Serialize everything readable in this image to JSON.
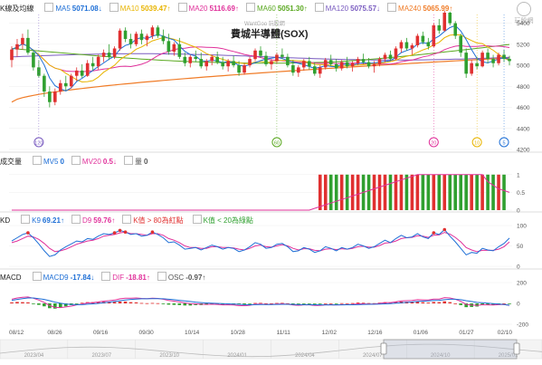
{
  "title": "費城半導體(SOX)",
  "watermark": "WantGoo 玩股網",
  "logo_text": "玩股網",
  "header_k": {
    "label": "K線及均線",
    "items": [
      {
        "name": "MA5",
        "value": "5071.08↓",
        "color": "#1e6fd6"
      },
      {
        "name": "MA10",
        "value": "5039.47↑",
        "color": "#e8b400"
      },
      {
        "name": "MA20",
        "value": "5116.69↑",
        "color": "#e0309a"
      },
      {
        "name": "MA60",
        "value": "5051.30↑",
        "color": "#5aa820"
      },
      {
        "name": "MA120",
        "value": "5075.57↓",
        "color": "#7a5cc0"
      },
      {
        "name": "MA240",
        "value": "5065.99↑",
        "color": "#f07c28"
      }
    ]
  },
  "header_vol": {
    "label": "成交量",
    "items": [
      {
        "name": "MV5",
        "value": "0",
        "color": "#1e6fd6"
      },
      {
        "name": "MV20",
        "value": "0.5↓",
        "color": "#e0309a"
      },
      {
        "name": "量",
        "value": "0",
        "color": "#555"
      }
    ]
  },
  "header_kd": {
    "label": "KD",
    "items": [
      {
        "name": "K9",
        "value": "69.21↑",
        "color": "#1e6fd6"
      },
      {
        "name": "D9",
        "value": "59.76↑",
        "color": "#e0309a"
      },
      {
        "name": "K值 > 80為紅點",
        "value": "",
        "color": "#e03030"
      },
      {
        "name": "K值 < 20為綠點",
        "value": "",
        "color": "#30a030"
      }
    ]
  },
  "header_macd": {
    "label": "MACD",
    "items": [
      {
        "name": "MACD9",
        "value": "-17.84↓",
        "color": "#1e6fd6"
      },
      {
        "name": "DIF",
        "value": "-18.81↑",
        "color": "#e0309a"
      },
      {
        "name": "OSC",
        "value": "-0.97↑",
        "color": "#555"
      }
    ]
  },
  "chart_data": {
    "type": "candlestick",
    "price_axis": {
      "ticks": [
        4200,
        4400,
        4600,
        4800,
        5000,
        5200,
        5400
      ],
      "range": [
        4200,
        5500
      ]
    },
    "volume_axis": {
      "ticks": [
        0,
        0.5,
        1
      ]
    },
    "kd_axis": {
      "ticks": [
        0,
        50,
        100
      ]
    },
    "macd_axis": {
      "ticks": [
        -200,
        0,
        200
      ]
    },
    "date_ticks": [
      "08/12",
      "08/26",
      "09/16",
      "09/30",
      "10/14",
      "10/28",
      "11/11",
      "12/02",
      "12/16",
      "01/06",
      "01/27",
      "02/10"
    ],
    "scroll_ticks": [
      "2023/04",
      "2023/07",
      "2023/10",
      "2024/01",
      "2024/04",
      "2024/07",
      "2024/10",
      "2025/01"
    ],
    "markers": [
      {
        "label": "120",
        "color": "#7a5cc0",
        "index": 5
      },
      {
        "label": "60",
        "color": "#5aa820",
        "index": 49
      },
      {
        "label": "20",
        "color": "#e0309a",
        "index": 78
      },
      {
        "label": "10",
        "color": "#e8b400",
        "index": 86
      },
      {
        "label": "5",
        "color": "#1e6fd6",
        "index": 91
      }
    ],
    "candles": [
      [
        5050,
        5180,
        4980,
        5150
      ],
      [
        5150,
        5250,
        5080,
        5200
      ],
      [
        5200,
        5300,
        5150,
        5260
      ],
      [
        5260,
        5340,
        5100,
        5120
      ],
      [
        5120,
        5150,
        4950,
        4980
      ],
      [
        4980,
        5050,
        4880,
        4900
      ],
      [
        4900,
        4920,
        4700,
        4750
      ],
      [
        4750,
        4800,
        4600,
        4650
      ],
      [
        4650,
        4780,
        4620,
        4750
      ],
      [
        4750,
        4860,
        4720,
        4830
      ],
      [
        4830,
        4900,
        4760,
        4800
      ],
      [
        4800,
        4920,
        4780,
        4900
      ],
      [
        4900,
        4980,
        4850,
        4950
      ],
      [
        4950,
        5010,
        4880,
        4900
      ],
      [
        4900,
        5050,
        4890,
        5020
      ],
      [
        5020,
        5080,
        4950,
        4990
      ],
      [
        4990,
        5100,
        4960,
        5080
      ],
      [
        5080,
        5150,
        5030,
        5120
      ],
      [
        5120,
        5200,
        5050,
        5080
      ],
      [
        5080,
        5180,
        5060,
        5160
      ],
      [
        5160,
        5350,
        5140,
        5330
      ],
      [
        5330,
        5360,
        5220,
        5250
      ],
      [
        5250,
        5300,
        5160,
        5200
      ],
      [
        5200,
        5320,
        5180,
        5300
      ],
      [
        5300,
        5340,
        5200,
        5240
      ],
      [
        5240,
        5300,
        5180,
        5280
      ],
      [
        5280,
        5380,
        5250,
        5360
      ],
      [
        5360,
        5380,
        5260,
        5280
      ],
      [
        5280,
        5340,
        5200,
        5230
      ],
      [
        5230,
        5300,
        5100,
        5130
      ],
      [
        5130,
        5220,
        5090,
        5200
      ],
      [
        5200,
        5260,
        5060,
        5080
      ],
      [
        5080,
        5120,
        4990,
        5020
      ],
      [
        5020,
        5100,
        4980,
        5080
      ],
      [
        5080,
        5140,
        5030,
        5060
      ],
      [
        5060,
        5120,
        4970,
        4990
      ],
      [
        4990,
        5060,
        4950,
        5040
      ],
      [
        5040,
        5100,
        5000,
        5080
      ],
      [
        5080,
        5130,
        5010,
        5030
      ],
      [
        5030,
        5080,
        4960,
        4990
      ],
      [
        4990,
        5060,
        4940,
        5040
      ],
      [
        5040,
        5090,
        4980,
        5000
      ],
      [
        5000,
        5040,
        4900,
        4930
      ],
      [
        4930,
        5020,
        4910,
        5000
      ],
      [
        5000,
        5080,
        4980,
        5060
      ],
      [
        5060,
        5160,
        5040,
        5140
      ],
      [
        5140,
        5180,
        5070,
        5090
      ],
      [
        5090,
        5130,
        4990,
        5010
      ],
      [
        5010,
        5060,
        4960,
        5040
      ],
      [
        5040,
        5120,
        5020,
        5100
      ],
      [
        5100,
        5160,
        5060,
        5080
      ],
      [
        5080,
        5110,
        4980,
        5000
      ],
      [
        5000,
        5050,
        4900,
        4930
      ],
      [
        4930,
        5000,
        4890,
        4980
      ],
      [
        4980,
        5060,
        4950,
        5040
      ],
      [
        5040,
        5080,
        4960,
        4990
      ],
      [
        4990,
        5030,
        4900,
        4920
      ],
      [
        4920,
        5000,
        4880,
        4980
      ],
      [
        4980,
        5070,
        4960,
        5050
      ],
      [
        5050,
        5100,
        4990,
        5010
      ],
      [
        5010,
        5060,
        4940,
        4970
      ],
      [
        4970,
        5050,
        4950,
        5030
      ],
      [
        5030,
        5080,
        4970,
        4990
      ],
      [
        4990,
        5040,
        4940,
        5020
      ],
      [
        5020,
        5080,
        5000,
        5060
      ],
      [
        5060,
        5110,
        5010,
        5030
      ],
      [
        5030,
        5070,
        4970,
        4990
      ],
      [
        4990,
        5040,
        4930,
        5010
      ],
      [
        5010,
        5080,
        4990,
        5060
      ],
      [
        5060,
        5120,
        5030,
        5100
      ],
      [
        5100,
        5140,
        5040,
        5060
      ],
      [
        5060,
        5180,
        5050,
        5160
      ],
      [
        5160,
        5240,
        5120,
        5220
      ],
      [
        5220,
        5260,
        5140,
        5160
      ],
      [
        5160,
        5210,
        5100,
        5190
      ],
      [
        5190,
        5300,
        5170,
        5280
      ],
      [
        5280,
        5320,
        5200,
        5220
      ],
      [
        5220,
        5260,
        5150,
        5180
      ],
      [
        5180,
        5400,
        5170,
        5380
      ],
      [
        5380,
        5440,
        5300,
        5330
      ],
      [
        5330,
        5520,
        5320,
        5500
      ],
      [
        5500,
        5510,
        5380,
        5400
      ],
      [
        5400,
        5420,
        5250,
        5280
      ],
      [
        5280,
        5300,
        5080,
        5120
      ],
      [
        5120,
        5160,
        4880,
        4920
      ],
      [
        4920,
        5050,
        4900,
        5020
      ],
      [
        5020,
        5080,
        4960,
        4990
      ],
      [
        4990,
        5140,
        4980,
        5120
      ],
      [
        5120,
        5160,
        5020,
        5060
      ],
      [
        5060,
        5100,
        4980,
        5020
      ],
      [
        5020,
        5120,
        5000,
        5100
      ],
      [
        5100,
        5150,
        5030,
        5060
      ],
      [
        5060,
        5090,
        5000,
        5040
      ]
    ],
    "kd_k": [
      62,
      70,
      78,
      82,
      70,
      55,
      38,
      24,
      28,
      40,
      48,
      55,
      62,
      60,
      68,
      66,
      74,
      80,
      78,
      82,
      88,
      84,
      78,
      80,
      74,
      76,
      84,
      78,
      70,
      58,
      60,
      52,
      42,
      44,
      46,
      40,
      46,
      52,
      48,
      42,
      46,
      44,
      36,
      40,
      48,
      58,
      54,
      44,
      46,
      54,
      56,
      48,
      36,
      38,
      46,
      42,
      34,
      38,
      48,
      44,
      38,
      46,
      42,
      46,
      54,
      50,
      44,
      48,
      56,
      64,
      58,
      68,
      76,
      70,
      72,
      80,
      72,
      68,
      82,
      78,
      90,
      74,
      60,
      44,
      28,
      34,
      32,
      44,
      40,
      38,
      48,
      56,
      69
    ],
    "kd_d": [
      58,
      62,
      68,
      74,
      72,
      66,
      56,
      44,
      36,
      38,
      42,
      48,
      54,
      58,
      62,
      64,
      68,
      74,
      76,
      78,
      82,
      84,
      80,
      80,
      78,
      76,
      80,
      80,
      76,
      68,
      64,
      58,
      50,
      46,
      46,
      44,
      44,
      48,
      48,
      46,
      46,
      45,
      42,
      40,
      44,
      50,
      52,
      48,
      47,
      50,
      53,
      50,
      44,
      40,
      43,
      43,
      39,
      38,
      42,
      43,
      41,
      43,
      42,
      44,
      48,
      49,
      47,
      47,
      51,
      57,
      58,
      62,
      68,
      70,
      71,
      75,
      74,
      71,
      76,
      77,
      83,
      79,
      71,
      60,
      46,
      40,
      36,
      39,
      39,
      39,
      42,
      48,
      59.76
    ],
    "macd_dif": [
      40,
      52,
      58,
      62,
      50,
      32,
      10,
      -20,
      -38,
      -40,
      -34,
      -26,
      -14,
      -6,
      4,
      8,
      14,
      22,
      26,
      32,
      44,
      50,
      50,
      52,
      48,
      46,
      50,
      48,
      40,
      28,
      22,
      14,
      4,
      -2,
      -4,
      -8,
      -10,
      -8,
      -10,
      -14,
      -14,
      -16,
      -22,
      -22,
      -18,
      -8,
      -6,
      -10,
      -10,
      -6,
      -4,
      -8,
      -16,
      -18,
      -14,
      -14,
      -20,
      -20,
      -14,
      -14,
      -16,
      -12,
      -12,
      -10,
      -4,
      -4,
      -6,
      -6,
      0,
      8,
      8,
      16,
      24,
      26,
      28,
      36,
      34,
      32,
      42,
      42,
      56,
      52,
      40,
      20,
      -10,
      -16,
      -20,
      -12,
      -14,
      -16,
      -12,
      -10,
      -18.81
    ],
    "macd_signal": [
      30,
      38,
      46,
      52,
      52,
      46,
      38,
      26,
      12,
      2,
      -6,
      -10,
      -12,
      -12,
      -8,
      -4,
      0,
      6,
      12,
      18,
      26,
      32,
      38,
      42,
      44,
      44,
      46,
      46,
      44,
      40,
      36,
      30,
      24,
      18,
      12,
      8,
      4,
      2,
      0,
      -2,
      -4,
      -6,
      -9,
      -12,
      -13,
      -12,
      -11,
      -11,
      -11,
      -10,
      -9,
      -9,
      -10,
      -12,
      -12,
      -12,
      -13,
      -14,
      -14,
      -14,
      -14,
      -14,
      -13,
      -13,
      -12,
      -10,
      -9,
      -8,
      -7,
      -4,
      -2,
      2,
      6,
      10,
      14,
      18,
      22,
      24,
      28,
      30,
      36,
      40,
      40,
      36,
      26,
      18,
      10,
      6,
      2,
      -2,
      -6,
      -10,
      -17.84
    ],
    "volume": [
      0,
      0,
      0,
      0,
      0,
      0,
      0,
      0,
      0,
      0,
      0,
      0,
      0,
      0,
      0,
      0,
      0,
      0,
      0,
      0,
      0,
      0,
      0,
      0,
      0,
      0,
      0,
      0,
      0,
      0,
      0,
      0,
      0,
      0,
      0,
      0,
      0,
      0,
      0,
      0,
      0,
      0,
      0,
      0,
      0,
      0,
      0,
      0,
      0,
      0,
      0,
      0,
      0,
      0,
      0,
      0,
      0,
      1,
      1,
      1,
      1,
      1,
      1,
      1,
      1,
      1,
      1,
      1,
      1,
      1,
      1,
      1,
      1,
      1,
      1,
      1,
      1,
      1,
      1,
      1,
      1,
      1,
      1,
      1,
      1,
      1,
      1,
      1,
      1,
      1,
      1,
      1,
      0
    ],
    "mv20": [
      0,
      0,
      0,
      0,
      0,
      0,
      0,
      0,
      0,
      0,
      0,
      0,
      0,
      0,
      0,
      0,
      0,
      0,
      0,
      0,
      0,
      0,
      0,
      0,
      0,
      0,
      0,
      0,
      0,
      0,
      0,
      0,
      0,
      0,
      0,
      0,
      0,
      0,
      0,
      0,
      0,
      0,
      0,
      0,
      0,
      0,
      0,
      0,
      0,
      0,
      0,
      0,
      0,
      0,
      0,
      0,
      0.05,
      0.1,
      0.15,
      0.2,
      0.25,
      0.3,
      0.35,
      0.4,
      0.45,
      0.5,
      0.55,
      0.6,
      0.65,
      0.7,
      0.75,
      0.8,
      0.85,
      0.9,
      0.95,
      1,
      1,
      1,
      1,
      1,
      1,
      1,
      1,
      1,
      1,
      1,
      1,
      1,
      0.8,
      0.7,
      0.6,
      0.55,
      0.5
    ]
  }
}
